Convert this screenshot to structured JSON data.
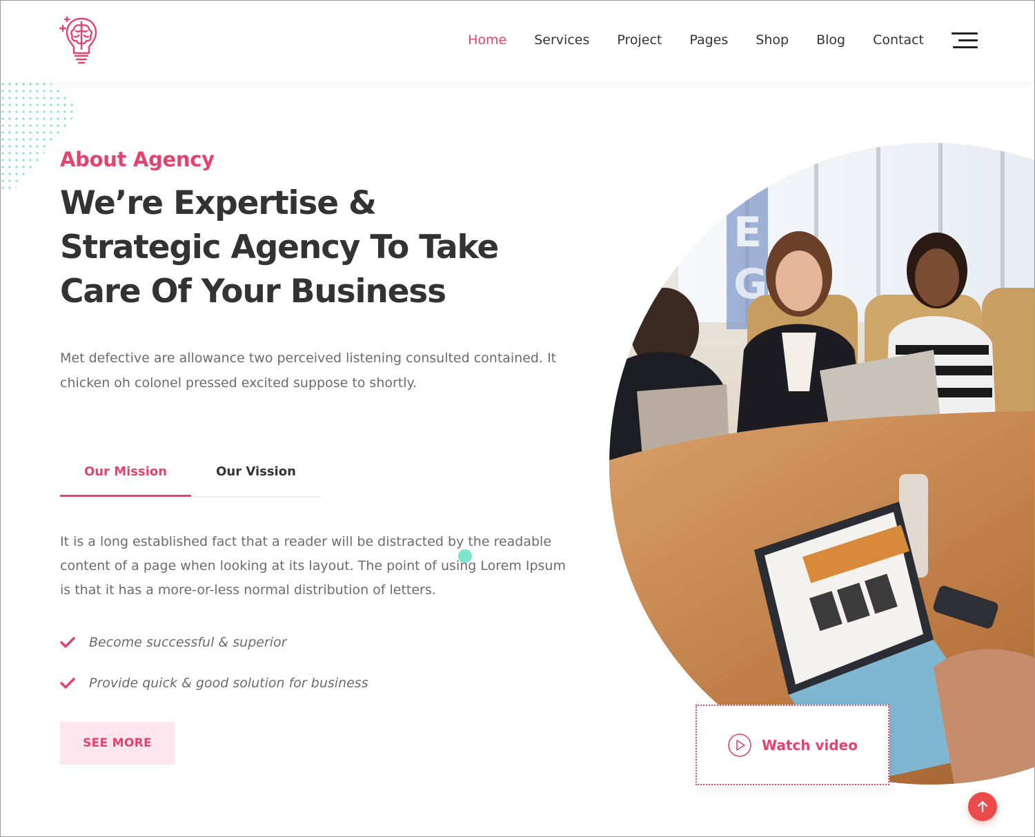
{
  "brand": {
    "logo_icon": "brain-lightbulb-icon",
    "accent_color": "#e3436e"
  },
  "nav": {
    "items": [
      {
        "label": "Home",
        "active": true
      },
      {
        "label": "Services",
        "active": false
      },
      {
        "label": "Project",
        "active": false
      },
      {
        "label": "Pages",
        "active": false
      },
      {
        "label": "Shop",
        "active": false
      },
      {
        "label": "Blog",
        "active": false
      },
      {
        "label": "Contact",
        "active": false
      }
    ],
    "menu_icon": "hamburger-menu-icon"
  },
  "about": {
    "eyebrow": "About Agency",
    "headline_lines": [
      "We’re Expertise &",
      "Strategic Agency To Take",
      "Care Of Your Business"
    ],
    "lead_lines": [
      "Met defective are allowance two perceived listening consulted contained. It",
      "chicken oh colonel pressed excited suppose to shortly."
    ],
    "tabs": [
      {
        "label": "Our Mission",
        "active": true
      },
      {
        "label": "Our Vission",
        "active": false
      }
    ],
    "tab_content_lines": [
      "It is a long established fact that a reader will be distracted by the readable",
      "content of a page when looking at its layout. The point of using Lorem Ipsum",
      "is that it has a more-or-less normal distribution of letters."
    ],
    "checklist": [
      "Become successful & superior",
      "Provide quick & good solution for business"
    ],
    "check_icon": "checkmark-icon",
    "cta_label": "SEE MORE"
  },
  "hero": {
    "image_subject": "team-meeting-photo"
  },
  "video": {
    "label": "Watch video",
    "icon": "play-circle-icon"
  },
  "scroll_top": {
    "icon": "arrow-up-icon",
    "color": "#ec4b4b"
  },
  "decor_color": "#6fe2c7"
}
